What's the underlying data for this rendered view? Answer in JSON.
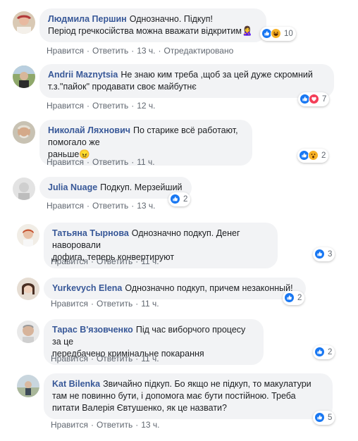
{
  "actions": {
    "like": "Нравится",
    "reply": "Ответить",
    "sep": "·",
    "edited": "Отредактировано"
  },
  "comments": [
    {
      "author": "Людмила Першин",
      "text_line1": "Однозначно. Підкуп!",
      "text_line2": "Період гречкосійства можна вважати відкритим",
      "emoji": "🙎‍♀️",
      "time": "13 ч.",
      "reactions": [
        "like-icon",
        "haha-icon"
      ],
      "count": "10"
    },
    {
      "author": "Andrii Maznytsia",
      "text_line1": "Не знаю ким треба ,щоб за цей дуже скромний",
      "text_line2": "т.з.\"пайок\" продавати своє майбутнє",
      "time": "12 ч.",
      "reactions": [
        "like-icon",
        "love-icon"
      ],
      "count": "7"
    },
    {
      "author": "Николай Ляхнович",
      "text_line1": "По старике всё работают, помогало же",
      "text_line2": "раньше",
      "emoji": "😠",
      "time": "11 ч.",
      "reactions": [
        "like-icon",
        "wow-icon"
      ],
      "count": "2"
    },
    {
      "author": "Julia Nuage",
      "text_line1": "Подкуп. Мерзейший",
      "time": "13 ч.",
      "reactions": [
        "like-icon"
      ],
      "count": "2"
    },
    {
      "author": "Татьяна Тырнова",
      "text_line1": "Однозначно подкуп. Денег наворовали",
      "text_line2": "дофига, теперь конвертируют",
      "time": "11 ч.",
      "reactions": [
        "like-icon"
      ],
      "count": "3"
    },
    {
      "author": "Yurkevych Elena",
      "text_line1": "Однозначно подкуп, причем незаконный!",
      "time": "11 ч.",
      "reactions": [
        "like-icon"
      ],
      "count": "2"
    },
    {
      "author": "Тарас В'язовченко",
      "text_line1": "Під час виборчого процесу за це",
      "text_line2": "передбачено кримінальне покарання",
      "time": "11 ч.",
      "reactions": [
        "like-icon"
      ],
      "count": "2"
    },
    {
      "author": "Kat Bilenka",
      "text_line1": "Звичайно підкуп. Бо якщо не підкуп, то макулатури",
      "text_line2": "там не повинно бути, і допомога має бути постійною. Треба",
      "text_line3": "питати Валерія Євтушенко, як це назвати?",
      "time": "13 ч.",
      "reactions": [
        "like-icon"
      ],
      "count": "5"
    }
  ],
  "colors": {
    "link": "#385898",
    "bubble": "#f2f3f5",
    "meta": "#606770",
    "like": "#1877f2",
    "love": "#f33e58",
    "haha": "#f7b125"
  }
}
